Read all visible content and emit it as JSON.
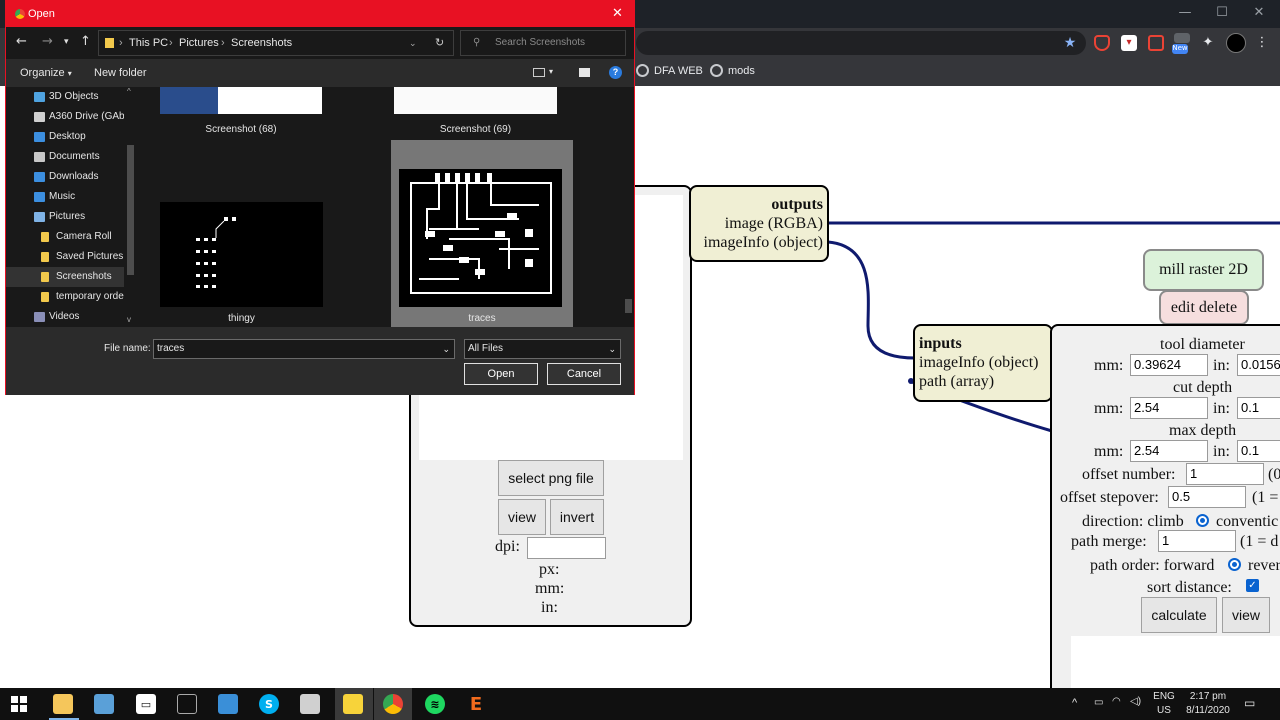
{
  "browser": {
    "bookmarks": [
      {
        "label": "DFA WEB"
      },
      {
        "label": "mods"
      }
    ],
    "new_badge": "New"
  },
  "dialog": {
    "title": "Open",
    "breadcrumb": [
      "This PC",
      "Pictures",
      "Screenshots"
    ],
    "search_placeholder": "Search Screenshots",
    "toolbar": {
      "organize": "Organize",
      "new_folder": "New folder"
    },
    "nav_items": [
      {
        "label": "3D Objects",
        "color": "#4fa3e0"
      },
      {
        "label": "A360 Drive (GAb",
        "color": "#d0d0d0"
      },
      {
        "label": "Desktop",
        "color": "#3c8fe0"
      },
      {
        "label": "Documents",
        "color": "#c8c8c8"
      },
      {
        "label": "Downloads",
        "color": "#3c8fe0"
      },
      {
        "label": "Music",
        "color": "#3c8fe0"
      },
      {
        "label": "Pictures",
        "color": "#7fb3e6"
      },
      {
        "label": "Camera Roll",
        "color": "#f2c94c"
      },
      {
        "label": "Saved Pictures",
        "color": "#f2c94c"
      },
      {
        "label": "Screenshots",
        "color": "#f2c94c"
      },
      {
        "label": "temporary orde",
        "color": "#f2c94c"
      },
      {
        "label": "Videos",
        "color": "#8a8fb8"
      }
    ],
    "files": [
      {
        "label": "Screenshot (68)"
      },
      {
        "label": "Screenshot (69)"
      },
      {
        "label": "thingy"
      },
      {
        "label": "traces"
      }
    ],
    "file_name_label": "File name:",
    "file_name_value": "traces",
    "file_type": "All Files",
    "open_label": "Open",
    "cancel_label": "Cancel"
  },
  "read_png": {
    "select_label": "select png file",
    "view_label": "view",
    "invert_label": "invert",
    "dpi_label": "dpi:",
    "px_label": "px:",
    "mm_label": "mm:",
    "in_label": "in:"
  },
  "outputs_node": {
    "title": "outputs",
    "items": [
      "image (RGBA)",
      "imageInfo (object)"
    ]
  },
  "inputs_node": {
    "title": "inputs",
    "items": [
      "imageInfo (object)",
      "path (array)"
    ]
  },
  "mill_raster": {
    "title": "mill raster 2D",
    "edit_delete": "edit delete",
    "tool_diameter": "tool diameter",
    "tool_mm": "0.39624",
    "tool_in": "0.0156",
    "cut_depth": "cut depth",
    "cut_mm": "2.54",
    "cut_in": "0.1",
    "max_depth": "max depth",
    "max_mm": "2.54",
    "max_in": "0.1",
    "mm_label": "mm:",
    "in_label": "in:",
    "offset_number_label": "offset number:",
    "offset_number": "1",
    "offset_number_note": "(0",
    "offset_stepover_label": "offset stepover:",
    "offset_stepover": "0.5",
    "offset_stepover_note": "(1 =",
    "direction_label": "direction: climb",
    "direction_alt": "conventic",
    "path_merge_label": "path merge:",
    "path_merge": "1",
    "path_merge_note": "(1 = d",
    "path_order_label": "path order: forward",
    "path_order_alt": "rever",
    "sort_distance_label": "sort distance:",
    "calculate_label": "calculate",
    "view_label": "view"
  },
  "taskbar": {
    "lang": "ENG",
    "region": "US",
    "time": "2:17 pm",
    "date": "8/11/2020"
  }
}
